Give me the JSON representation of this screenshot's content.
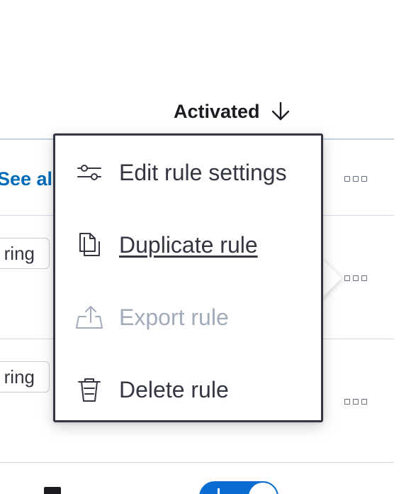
{
  "table": {
    "sort_column_label": "Activated",
    "see_all_link": "See all",
    "tag_badge_text": "ring"
  },
  "context_menu": {
    "items": [
      {
        "label": "Edit rule settings",
        "icon": "sliders-icon",
        "state": "normal"
      },
      {
        "label": "Duplicate rule",
        "icon": "copy-icon",
        "state": "focused"
      },
      {
        "label": "Export rule",
        "icon": "export-icon",
        "state": "disabled"
      },
      {
        "label": "Delete rule",
        "icon": "trash-icon",
        "state": "normal"
      }
    ]
  },
  "colors": {
    "link": "#006bb8",
    "text": "#343741",
    "disabled_text": "#a2abba",
    "toggle_on": "#0b6cd1",
    "popover_border": "#343741"
  },
  "toggle": {
    "checked": true
  }
}
